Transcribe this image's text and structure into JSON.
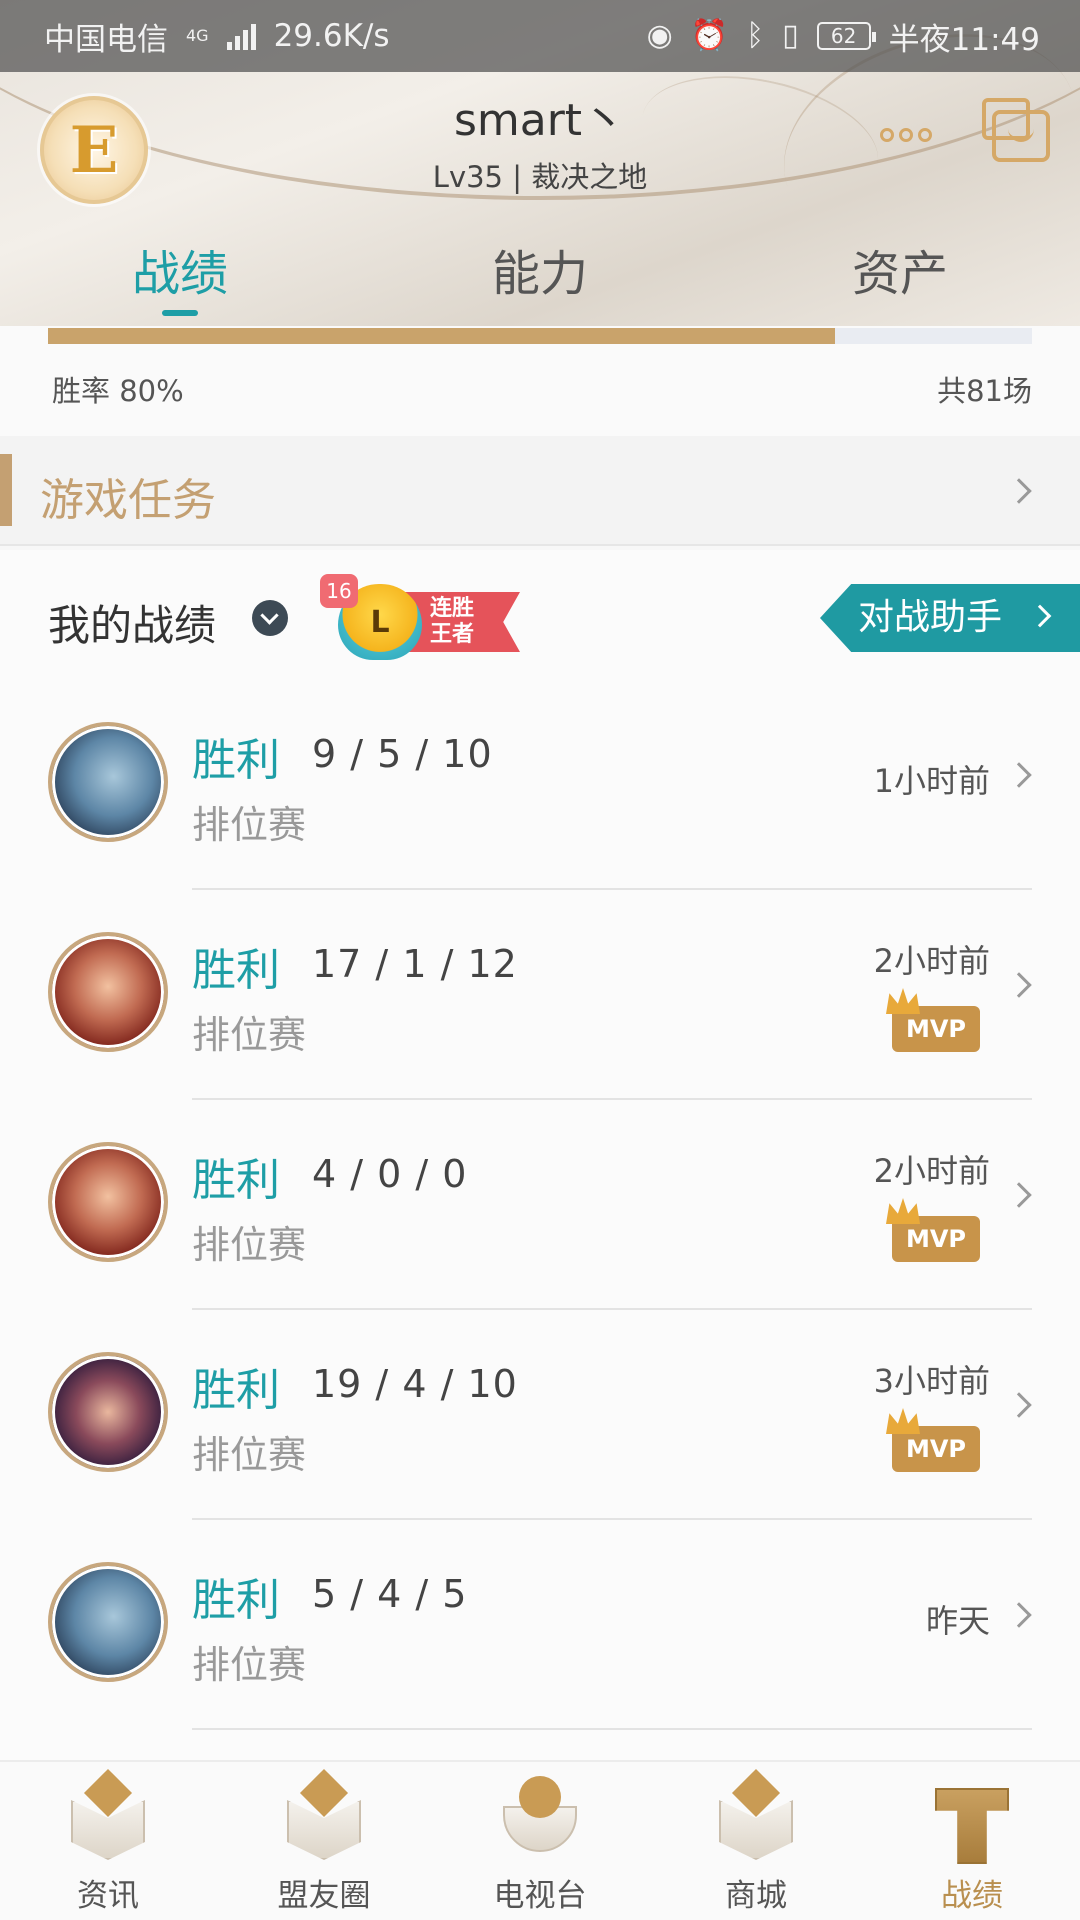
{
  "status_bar": {
    "carrier": "中国电信",
    "network": "4G",
    "speed": "29.6K/s",
    "battery": "62",
    "time": "半夜11:49"
  },
  "profile": {
    "name": "smart丶",
    "subtitle": "Lv35 | 裁决之地"
  },
  "tabs": [
    {
      "label": "战绩",
      "active": true
    },
    {
      "label": "能力",
      "active": false
    },
    {
      "label": "资产",
      "active": false
    }
  ],
  "winrate": {
    "label": "胜率  80%",
    "total": "共81场",
    "fill_fraction": 0.8
  },
  "task": {
    "title": "游戏任务"
  },
  "records": {
    "title": "我的战绩",
    "streak_count": "16",
    "streak_letter": "L",
    "streak_text": "连胜王者",
    "assist_label": "对战助手"
  },
  "matches": [
    {
      "result": "胜利",
      "kda": "9 / 5 / 10",
      "mode": "排位赛",
      "time": "1小时前",
      "mvp": false,
      "hero_icon": "fizz-icon"
    },
    {
      "result": "胜利",
      "kda": "17 / 1 / 12",
      "mode": "排位赛",
      "time": "2小时前",
      "mvp": true,
      "hero_icon": "vladimir-icon"
    },
    {
      "result": "胜利",
      "kda": "4 / 0 / 0",
      "mode": "排位赛",
      "time": "2小时前",
      "mvp": true,
      "hero_icon": "vladimir-icon"
    },
    {
      "result": "胜利",
      "kda": "19 / 4 / 10",
      "mode": "排位赛",
      "time": "3小时前",
      "mvp": true,
      "hero_icon": "leblanc-icon"
    },
    {
      "result": "胜利",
      "kda": "5 / 4 / 5",
      "mode": "排位赛",
      "time": "昨天",
      "mvp": false,
      "hero_icon": "fizz-icon"
    }
  ],
  "mvp_label": "MVP",
  "bottom_nav": [
    {
      "label": "资讯",
      "icon": "news-icon",
      "active": false
    },
    {
      "label": "盟友圈",
      "icon": "friends-icon",
      "active": false
    },
    {
      "label": "电视台",
      "icon": "tv-icon",
      "active": false
    },
    {
      "label": "商城",
      "icon": "store-icon",
      "active": false
    },
    {
      "label": "战绩",
      "icon": "records-icon",
      "active": true
    }
  ],
  "colors": {
    "accent": "#1e9ea6",
    "gold": "#c4a072",
    "win": "#1e9ea6"
  }
}
